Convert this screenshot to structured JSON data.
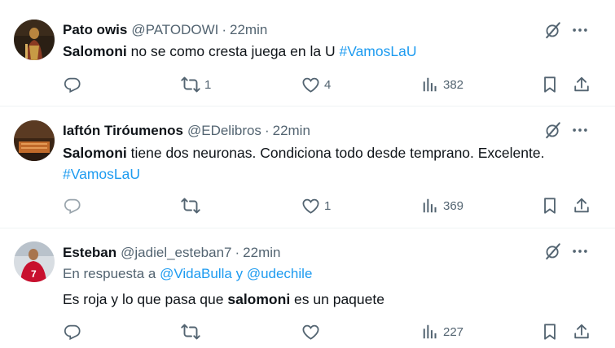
{
  "tweets": [
    {
      "name": "Pato owis",
      "handle": "@PATODOWI",
      "dot": "·",
      "time": "22min",
      "text_bold": "Salomoni",
      "text_rest": " no se como cresta juega en la U ",
      "hashtag": "#VamosLaU",
      "replies": "",
      "retweets": "1",
      "likes": "4",
      "views": "382"
    },
    {
      "name": "Iaftón Tiróumenos",
      "handle": "@EDelibros",
      "dot": "·",
      "time": "22min",
      "text_bold": "Salomoni",
      "text_rest": " tiene dos neuronas. Condiciona todo desde temprano. Excelente. ",
      "hashtag": "#VamosLaU",
      "replies": "",
      "retweets": "",
      "likes": "1",
      "views": "369"
    },
    {
      "name": "Esteban",
      "handle": "@jadiel_esteban7",
      "dot": "·",
      "time": "22min",
      "reply_prefix": "En respuesta a ",
      "reply_user1": "@VidaBulla",
      "reply_and": " y ",
      "reply_user2": "@udechile",
      "text_pre": "Es roja y lo que pasa que ",
      "text_bold": "salomoni",
      "text_rest": " es un paquete",
      "replies": "",
      "retweets": "",
      "likes": "",
      "views": "227"
    }
  ],
  "icons": {
    "reply": "reply-icon",
    "retweet": "retweet-icon",
    "like": "heart-icon",
    "views": "views-icon",
    "bookmark": "bookmark-icon",
    "share": "share-icon",
    "grok": "grok-icon",
    "more": "more-icon"
  },
  "colors": {
    "link": "#1d9bf0",
    "secondary": "#536471",
    "text": "#0f1419"
  }
}
